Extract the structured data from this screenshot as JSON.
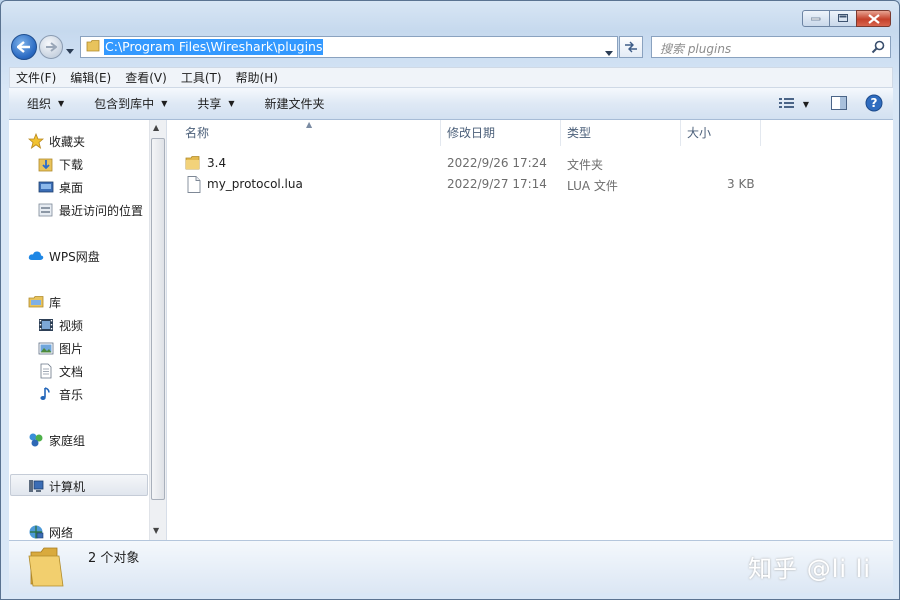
{
  "window": {
    "address_path": "C:\\Program Files\\Wireshark\\plugins",
    "search_placeholder": "搜索 plugins"
  },
  "menu": [
    "文件(F)",
    "编辑(E)",
    "查看(V)",
    "工具(T)",
    "帮助(H)"
  ],
  "commands": {
    "organize": "组织",
    "include_in_library": "包含到库中",
    "share": "共享",
    "new_folder": "新建文件夹"
  },
  "nav": {
    "favorites": "收藏夹",
    "downloads": "下载",
    "desktop": "桌面",
    "recent_places": "最近访问的位置",
    "wps_cloud": "WPS网盘",
    "libraries": "库",
    "videos": "视频",
    "pictures": "图片",
    "documents": "文档",
    "music": "音乐",
    "homegroup": "家庭组",
    "computer": "计算机",
    "network": "网络"
  },
  "columns": {
    "name": "名称",
    "date_modified": "修改日期",
    "type": "类型",
    "size": "大小"
  },
  "files": [
    {
      "name": "3.4",
      "date": "2022/9/26 17:24",
      "type": "文件夹",
      "size": "",
      "icon": "folder-icon"
    },
    {
      "name": "my_protocol.lua",
      "date": "2022/9/27 17:14",
      "type": "LUA 文件",
      "size": "3 KB",
      "icon": "file-icon"
    }
  ],
  "details": {
    "count_text": "2 个对象"
  },
  "watermark": "知乎 @li li"
}
